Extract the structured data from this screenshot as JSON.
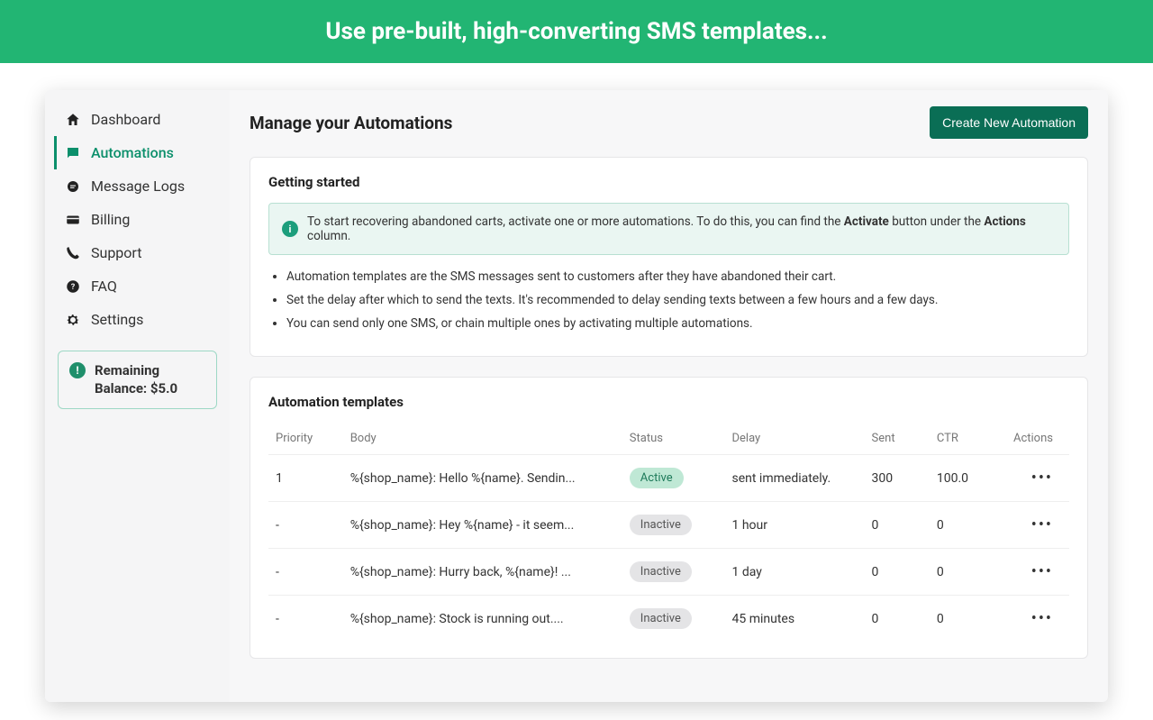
{
  "banner": {
    "headline": "Use pre-built, high-converting SMS templates..."
  },
  "sidebar": {
    "items": [
      {
        "label": "Dashboard",
        "icon": "home-icon"
      },
      {
        "label": "Automations",
        "icon": "chat-icon",
        "active": true
      },
      {
        "label": "Message Logs",
        "icon": "sms-icon"
      },
      {
        "label": "Billing",
        "icon": "card-icon"
      },
      {
        "label": "Support",
        "icon": "phone-icon"
      },
      {
        "label": "FAQ",
        "icon": "question-icon"
      },
      {
        "label": "Settings",
        "icon": "gear-icon"
      }
    ],
    "balance": {
      "label_line1": "Remaining",
      "label_line2": "Balance: $5.0"
    }
  },
  "main": {
    "title": "Manage your Automations",
    "create_btn": "Create New Automation",
    "getting_started": {
      "heading": "Getting started",
      "info_prefix": "To start recovering abandoned carts, activate one or more automations. To do this, you can find the ",
      "info_bold1": "Activate",
      "info_mid": " button under the ",
      "info_bold2": "Actions",
      "info_suffix": " column.",
      "bullets": [
        "Automation templates are the SMS messages sent to customers after they have abandoned their cart.",
        "Set the delay after which to send the texts. It's recommended to delay sending texts between a few hours and a few days.",
        "You can send only one SMS, or chain multiple ones by activating multiple automations."
      ]
    },
    "templates": {
      "heading": "Automation templates",
      "columns": {
        "priority": "Priority",
        "body": "Body",
        "status": "Status",
        "delay": "Delay",
        "sent": "Sent",
        "ctr": "CTR",
        "actions": "Actions"
      },
      "rows": [
        {
          "priority": "1",
          "body": "%{shop_name}: Hello %{name}. Sendin...",
          "status": "Active",
          "delay": "sent immediately.",
          "sent": "300",
          "ctr": "100.0"
        },
        {
          "priority": "-",
          "body": "%{shop_name}: Hey %{name} - it seem...",
          "status": "Inactive",
          "delay": "1 hour",
          "sent": "0",
          "ctr": "0"
        },
        {
          "priority": "-",
          "body": "%{shop_name}: Hurry back, %{name}! ...",
          "status": "Inactive",
          "delay": "1 day",
          "sent": "0",
          "ctr": "0"
        },
        {
          "priority": "-",
          "body": "%{shop_name}: Stock is running out....",
          "status": "Inactive",
          "delay": "45 minutes",
          "sent": "0",
          "ctr": "0"
        }
      ]
    }
  },
  "colors": {
    "brand_green": "#22b573",
    "dark_green": "#0a6e55"
  }
}
